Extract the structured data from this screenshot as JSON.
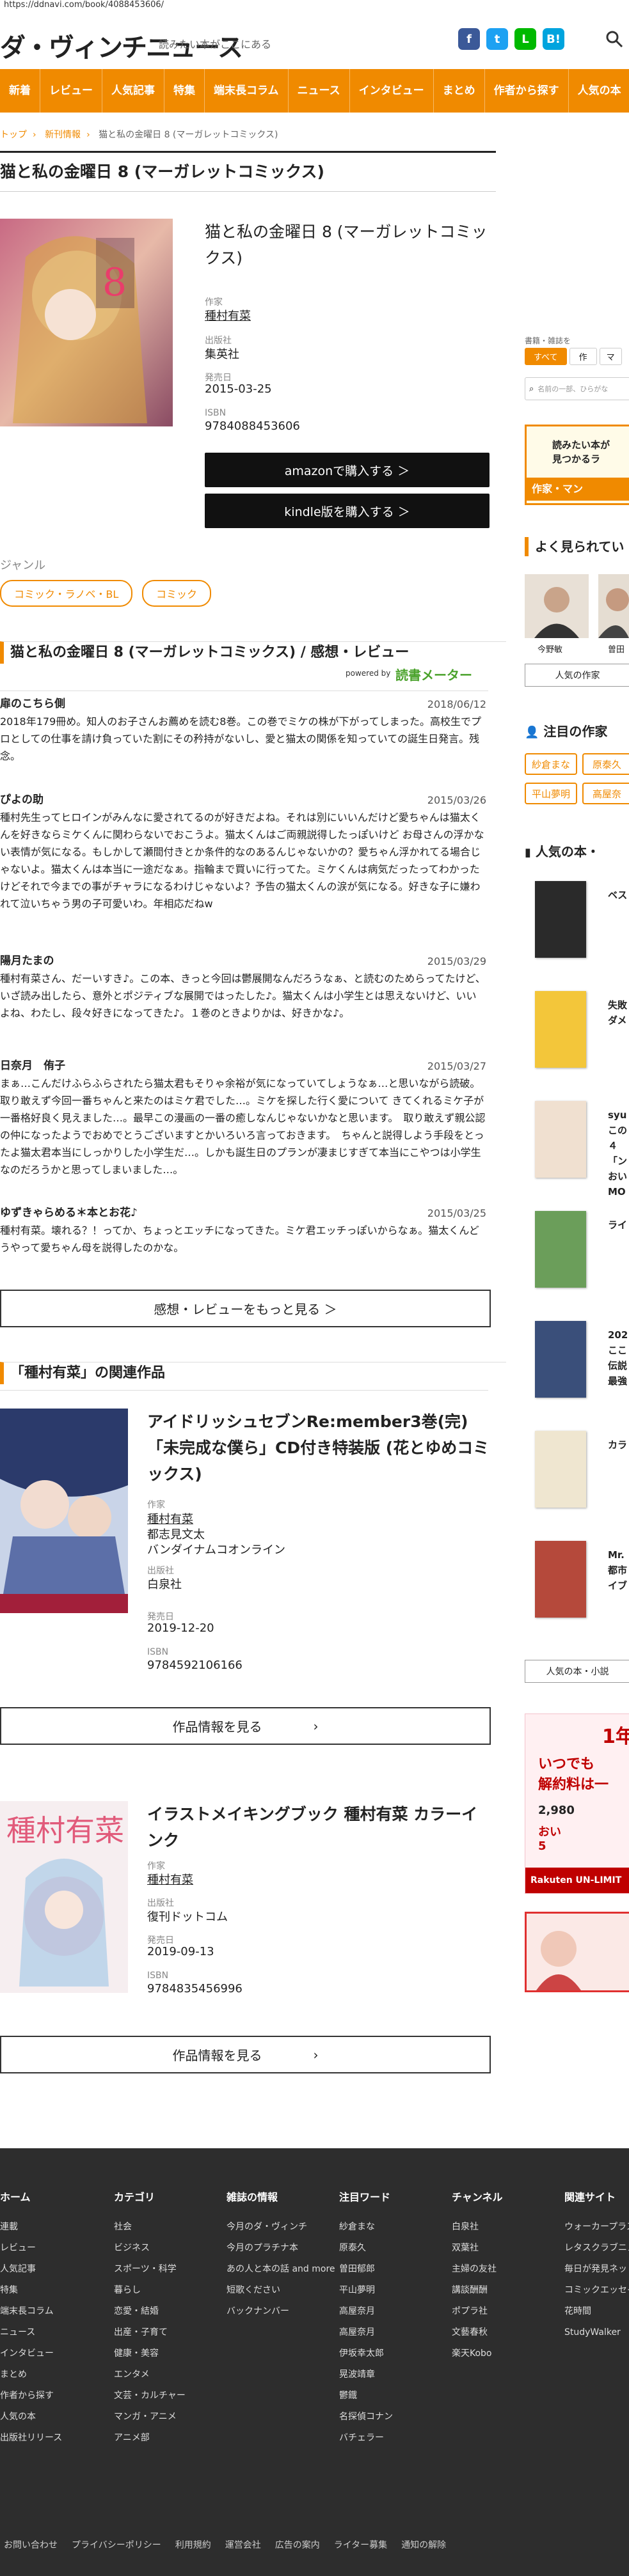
{
  "url": "https://ddnavi.com/book/4088453606/",
  "site": {
    "logo": "ダ・ヴィンチニュース",
    "tagline": "読みたい本がここにある"
  },
  "social": [
    {
      "name": "facebook-icon",
      "glyph": "f",
      "color": "#3b5998"
    },
    {
      "name": "twitter-icon",
      "glyph": "t",
      "color": "#1da1f2"
    },
    {
      "name": "line-icon",
      "glyph": "L",
      "color": "#00b900"
    },
    {
      "name": "hatena-icon",
      "glyph": "B!",
      "color": "#00a4de"
    }
  ],
  "nav": [
    "新着",
    "レビュー",
    "人気記事",
    "特集",
    "端末長コラム",
    "ニュース",
    "インタビュー",
    "まとめ",
    "作者から探す",
    "人気の本"
  ],
  "breadcrumb": {
    "home": "トップ",
    "parent": "新刊情報",
    "current": "猫と私の金曜日 8 (マーガレットコミックス)"
  },
  "page_title": "猫と私の金曜日 8 (マーガレットコミックス)",
  "book": {
    "title": "猫と私の金曜日 8 (マーガレットコミックス)",
    "author_label": "作家",
    "author": "種村有菜",
    "publisher_label": "出版社",
    "publisher": "集英社",
    "date_label": "発売日",
    "date": "2015-03-25",
    "isbn_label": "ISBN",
    "isbn": "9784088453606",
    "amazon_btn": "amazonで購入する ＞",
    "kindle_btn": "kindle版を購入する ＞"
  },
  "genre": {
    "label": "ジャンル",
    "tags": [
      "コミック・ラノベ・BL",
      "コミック"
    ]
  },
  "reviews_section": {
    "title": "猫と私の金曜日 8 (マーガレットコミックス) / 感想・レビュー",
    "powered": "powered by",
    "provider": "読書メーター",
    "items": [
      {
        "name": "扉のこちら側",
        "date": "2018/06/12",
        "text": "2018年179冊め。知人のお子さんお薦めを読む8巻。この巻でミケの株が下がってしまった。高校生でプロとしての仕事を請け負っていた割にその矜持がないし、愛と猫太の関係を知っていての誕生日発言。残念。"
      },
      {
        "name": "ぴよの助",
        "date": "2015/03/26",
        "text": "種村先生ってヒロインがみんなに愛されてるのが好きだよね。それは別にいいんだけど愛ちゃんは猫太くんを好きならミケくんに関わらないでおこうよ。猫太くんはご両親説得したっぽいけど お母さんの浮かない表情が気になる。もしかして瀬間付きとか条件的なのあるんじゃないかの？愛ちゃん浮かれてる場合じゃないよ。猫太くんは本当に一途だなぁ。指輪まで買いに行ってた。ミケくんは病気だったってわかったけどそれで今までの事がチャラになるわけじゃないよ？予告の猫太くんの涙が気になる。好きな子に嫌われて泣いちゃう男の子可愛いわ。年相応だねw"
      },
      {
        "name": "陽月たまの",
        "date": "2015/03/29",
        "text": "種村有菜さん、だーいすき♪。この本、きっと今回は鬱展開なんだろうなぁ、と読むのためらってたけど、いざ読み出したら、意外とポジティブな展開ではったした♪。猫太くんは小学生とは思えないけど、いいよね、わたし、段々好きになってきた♪。１巻のときよりかは、好きかな♪。"
      },
      {
        "name": "日奈月　侑子",
        "date": "2015/03/27",
        "text": "まぁ…こんだけふらふらされたら猫太君もそりゃ余裕が気になっていてしょうなぁ…と思いながら読破。取り敢えず今回一番ちゃんと来たのはミケ君でした…。ミケを探した行く愛について きてくれるミケ子が一番格好良く見えました…。最早この漫画の一番の癒しなんじゃないかなと思います。　取り敢えず親公認の仲になったようでおめでとうございますとかいろいろ言っておきます。　ちゃんと説得しよう手段をとったよ猫太君本当にしっかりした小学生だ…。しかも誕生日のプランが凄まじすぎて本当にこやつは小学生なのだろうかと思ってしまいました…。"
      },
      {
        "name": "ゆずきゃらめる＊本とお花♪",
        "date": "2015/03/25",
        "text": "種村有菜。壊れる？！ってか、ちょっとエッチになってきた。ミケ君エッチっぽいからなぁ。猫太くんどうやって愛ちゃん母を説得したのかな。"
      }
    ],
    "more_btn": "感想・レビューをもっと見る ＞"
  },
  "related": {
    "title": "「種村有菜」の関連作品",
    "items": [
      {
        "title": "アイドリッシュセブンRe:member3巻(完)「未完成な僕ら」CD付き特装版 (花とゆめコミックス)",
        "author_label": "作家",
        "authors": [
          "種村有菜",
          "都志見文太",
          "バンダイナムコオンライン"
        ],
        "publisher_label": "出版社",
        "publisher": "白泉社",
        "date_label": "発売日",
        "date": "2019-12-20",
        "isbn_label": "ISBN",
        "isbn": "9784592106166",
        "btn": "作品情報を見る"
      },
      {
        "title": "イラストメイキングブック 種村有菜 カラーインク",
        "author_label": "作家",
        "authors": [
          "種村有菜"
        ],
        "publisher_label": "出版社",
        "publisher": "復刊ドットコム",
        "date_label": "発売日",
        "date": "2019-09-13",
        "isbn_label": "ISBN",
        "isbn": "9784835456996",
        "btn": "作品情報を見る"
      }
    ]
  },
  "sidebar": {
    "search_label": "書籍・雑誌を",
    "search_tabs": [
      "すべて",
      "作",
      "マ"
    ],
    "search_placeholder": "名前の一部、ひらがな",
    "banner_lines": [
      "読みたい本が",
      "見つかるラ"
    ],
    "banner_bottom": "作家・マン",
    "popular_title": "よく見られてい",
    "people": [
      "今野敏",
      "曽田"
    ],
    "people_more": "人気の作家",
    "watch_title": "注目の作家",
    "watch_tags": [
      "紗倉まな",
      "原泰久",
      "平山夢明",
      "高屋奈"
    ],
    "books_title": "人気の本・",
    "books": [
      "ベス",
      "失敗 ダメ",
      "syu この ４ 「ン おい MO",
      "ライ",
      "202 ここ 伝説 最強",
      "カラ",
      "Mr. 都市 イブ"
    ],
    "books_more": "人気の本・小説",
    "ad_lines": [
      "1年",
      "いつでも",
      "解約料は一",
      "2,980",
      "おい",
      "5"
    ],
    "ad_brand": "Rakuten UN-LIMIT"
  },
  "footer": {
    "cols": [
      {
        "head": "ホーム",
        "items": [
          "連載",
          "レビュー",
          "人気記事",
          "特集",
          "端末長コラム",
          "ニュース",
          "インタビュー",
          "まとめ",
          "作者から探す",
          "人気の本",
          "出版社リリース"
        ]
      },
      {
        "head": "カテゴリ",
        "items": [
          "社会",
          "ビジネス",
          "スポーツ・科学",
          "暮らし",
          "恋愛・結婚",
          "出産・子育て",
          "健康・美容",
          "エンタメ",
          "文芸・カルチャー",
          "マンガ・アニメ",
          "アニメ部"
        ]
      },
      {
        "head": "雑誌の情報",
        "items": [
          "今月のダ・ヴィンチ",
          "今月のプラチナ本",
          "あの人と本の話 and more",
          "短歌ください",
          "バックナンバー"
        ]
      },
      {
        "head": "注目ワード",
        "items": [
          "紗倉まな",
          "原泰久",
          "曽田郁郎",
          "平山夢明",
          "高屋奈月",
          "高屋奈月",
          "伊坂幸太郎",
          "晃波靖章",
          "鬱鐡",
          "名探偵コナン",
          "バチェラー"
        ]
      },
      {
        "head": "チャンネル",
        "items": [
          "白泉社",
          "双葉社",
          "主婦の友社",
          "講談酬酬",
          "ポプラ社",
          "文藝春秋",
          "楽天Kobo"
        ]
      },
      {
        "head": "関連サイト",
        "items": [
          "ウォーカープラス",
          "レタスクラブニュース",
          "毎日が発見ネット",
          "コミックエッセイ劇場",
          "花時間",
          "StudyWalker"
        ]
      }
    ],
    "bottom": [
      "お問い合わせ",
      "プライバシーポリシー",
      "利用規約",
      "運営会社",
      "広告の案内",
      "ライター募集",
      "通知の解除"
    ]
  }
}
